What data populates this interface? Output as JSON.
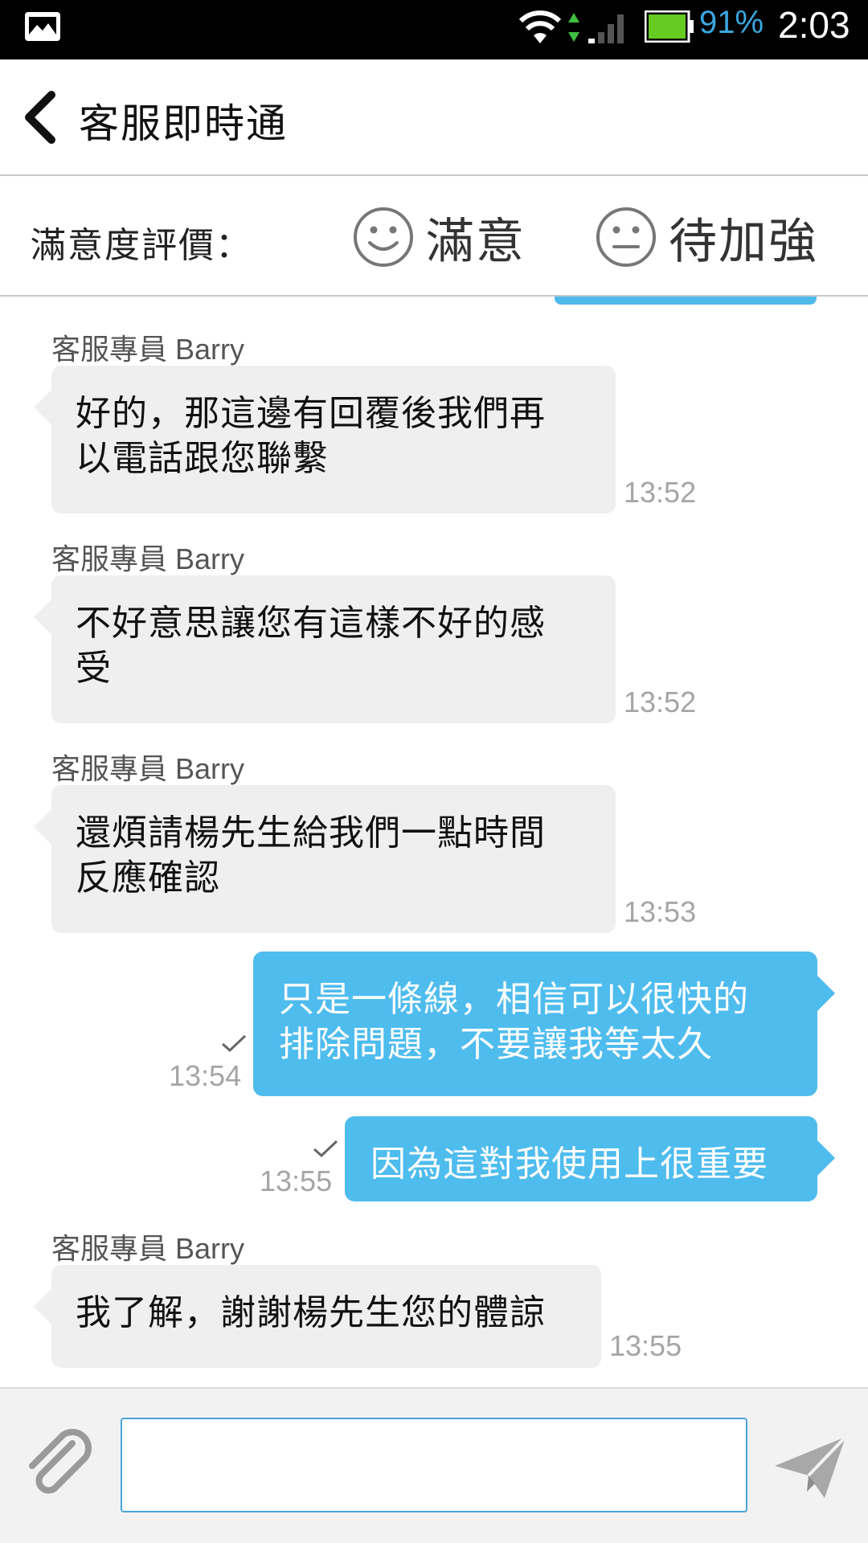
{
  "status_bar": {
    "battery_percent": "91%",
    "time": "2:03",
    "icons": [
      "gallery-icon",
      "wifi-icon",
      "data-arrows-icon",
      "signal-icon",
      "battery-icon"
    ],
    "battery_color": "#66cc22",
    "percent_color": "#3aa7e0"
  },
  "header": {
    "title": "客服即時通",
    "back_icon": "chevron-left-icon"
  },
  "rating": {
    "label": "滿意度評價：",
    "satisfied_label": "滿意",
    "satisfied_icon": "smile-face-icon",
    "improve_label": "待加強",
    "improve_icon": "neutral-face-icon"
  },
  "messages": [
    {
      "direction": "in",
      "sender": "客服專員 Barry",
      "lines": [
        "好的，那這邊有回覆後我們再",
        "以電話跟您聯繫"
      ],
      "time": "13:52"
    },
    {
      "direction": "in",
      "sender": "客服專員 Barry",
      "lines": [
        "不好意思讓您有這樣不好的感",
        "受"
      ],
      "time": "13:52"
    },
    {
      "direction": "in",
      "sender": "客服專員 Barry",
      "lines": [
        "還煩請楊先生給我們一點時間",
        "反應確認"
      ],
      "time": "13:53"
    },
    {
      "direction": "out",
      "lines": [
        "只是一條線，相信可以很快的",
        "排除問題，不要讓我等太久"
      ],
      "time": "13:54",
      "status_icon": "check-icon"
    },
    {
      "direction": "out",
      "lines": [
        "因為這對我使用上很重要"
      ],
      "time": "13:55",
      "status_icon": "check-icon"
    },
    {
      "direction": "in",
      "sender": "客服專員 Barry",
      "lines": [
        "我了解，謝謝楊先生您的體諒"
      ],
      "time": "13:55"
    }
  ],
  "input": {
    "value": "",
    "placeholder": "",
    "attach_icon": "paperclip-icon",
    "send_icon": "send-icon"
  },
  "colors": {
    "outgoing_bubble": "#4fbcee",
    "incoming_bubble": "#efefef",
    "input_border": "#4aa3d8"
  }
}
